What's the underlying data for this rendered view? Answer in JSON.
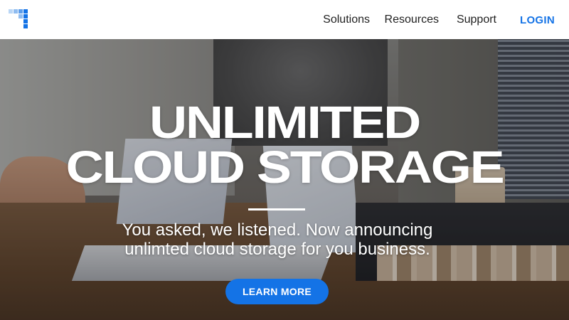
{
  "header": {
    "nav": [
      "Solutions",
      "Resources",
      "Support"
    ],
    "login_label": "LOGIN",
    "logo_icon": "pixel-grid-logo-icon"
  },
  "hero": {
    "headline_line1": "UNLIMITED",
    "headline_line2": "CLOUD STORAGE",
    "subtitle_line1": "You asked, we listened. Now announcing",
    "subtitle_line2": "unlimted cloud storage for you business.",
    "cta_label": "LEARN MORE"
  },
  "colors": {
    "accent": "#1473e6",
    "logo_light": "#9ec6f3",
    "logo_dark": "#1473e6",
    "nav_text": "#1f1f1f"
  }
}
